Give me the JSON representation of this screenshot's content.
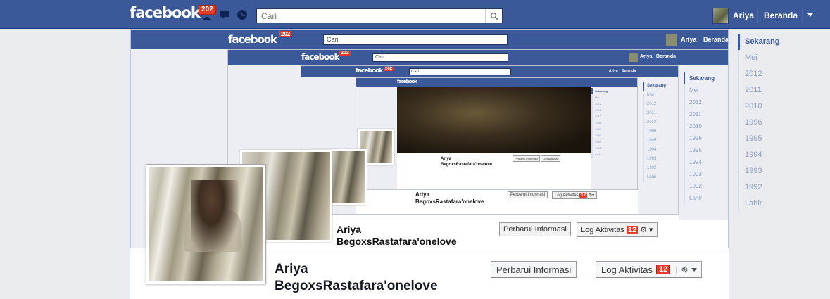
{
  "app": {
    "logo": "facebook",
    "notification_count": "202",
    "search_placeholder": "Cari",
    "user_name": "Ariya",
    "home_label": "Beranda"
  },
  "timeline": {
    "items": [
      {
        "label": "Sekarang",
        "active": true
      },
      {
        "label": "Mei"
      },
      {
        "label": "2012"
      },
      {
        "label": "2011"
      },
      {
        "label": "2010"
      },
      {
        "label": "1996"
      },
      {
        "label": "1995"
      },
      {
        "label": "1994"
      },
      {
        "label": "1993"
      },
      {
        "label": "1992"
      },
      {
        "label": "Lahir"
      }
    ]
  },
  "profile": {
    "first_name": "Ariya",
    "last_name": "BegoxsRastafara'onelove",
    "update_info_label": "Perbarui Informasi",
    "activity_log_label": "Log Aktivitas",
    "activity_log_count": "12",
    "gear_icon": "gear-icon"
  },
  "colors": {
    "brand": "#3b5998",
    "badge": "#e23c27",
    "timeline_text": "#8b9dc3"
  }
}
